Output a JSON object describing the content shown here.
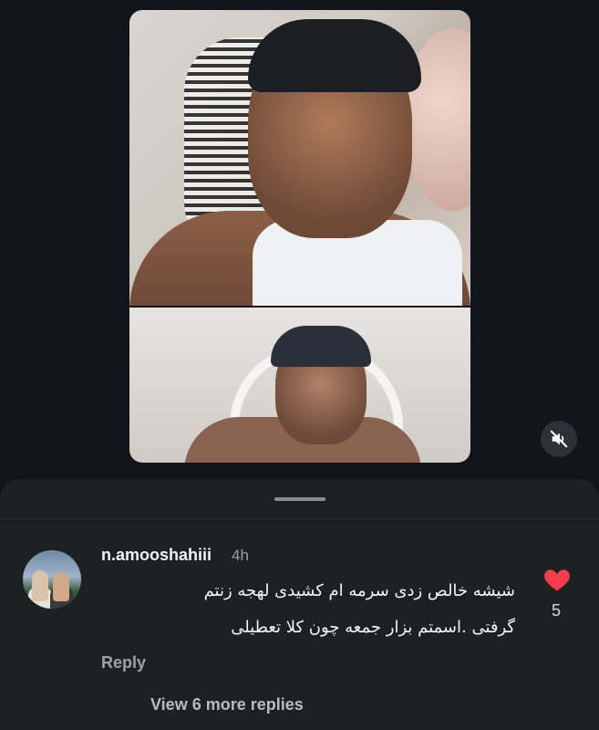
{
  "comment": {
    "username": "n.amooshahiii",
    "time": "4h",
    "text_line1": "شیشه خالص زدی سرمه ام کشیدی لهجه زنتم",
    "text_line2": "گرفتی .اسمتم بزار جمعه چون کلا تعطیلی",
    "like_count": "5",
    "reply_label": "Reply",
    "view_more_label": "View 6 more replies",
    "liked": true
  },
  "colors": {
    "like_red": "#f23d4f",
    "sheet_bg": "#1e2124"
  },
  "icons": {
    "mute": "speaker-muted-icon",
    "like": "heart-icon"
  }
}
